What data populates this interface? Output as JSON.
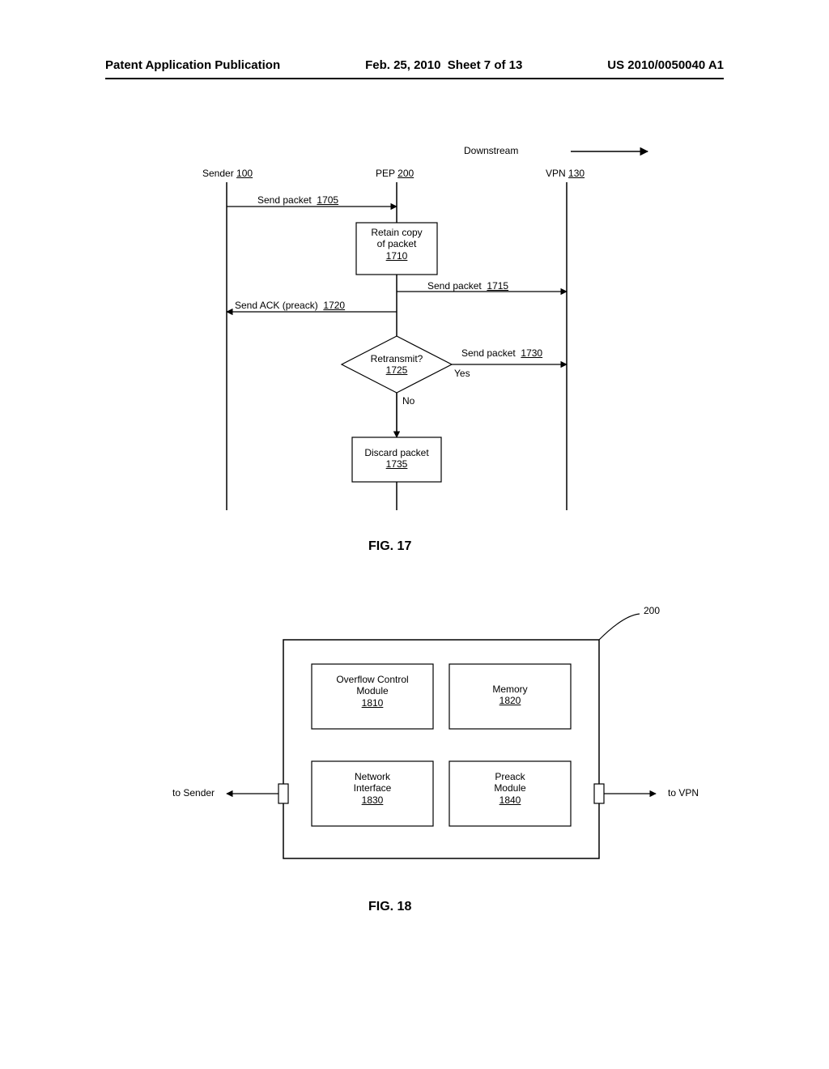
{
  "header": {
    "left": "Patent Application Publication",
    "date": "Feb. 25, 2010  Sheet 7 of 13",
    "right": "US 2010/0050040 A1"
  },
  "fig17": {
    "downstream": "Downstream",
    "lifelines": {
      "sender": {
        "label": "Sender",
        "ref": "100"
      },
      "pep": {
        "label": "PEP",
        "ref": "200"
      },
      "vpn": {
        "label": "VPN",
        "ref": "130"
      }
    },
    "msgs": {
      "send1705": {
        "text": "Send packet",
        "ref": "1705"
      },
      "send1715": {
        "text": "Send packet",
        "ref": "1715"
      },
      "ack1720": {
        "text": "Send ACK (preack)",
        "ref": "1720"
      },
      "send1730": {
        "text": "Send packet",
        "ref": "1730"
      }
    },
    "blocks": {
      "retain": {
        "text": "Retain copy\nof packet",
        "ref": "1710"
      },
      "decision": {
        "text": "Retransmit?",
        "ref": "1725",
        "yes": "Yes",
        "no": "No"
      },
      "discard": {
        "text": "Discard packet",
        "ref": "1735"
      }
    },
    "caption": "FIG. 17"
  },
  "fig18": {
    "ref": "200",
    "left_label": "to Sender",
    "right_label": "to VPN",
    "boxes": {
      "overflow": {
        "text": "Overflow Control\nModule",
        "ref": "1810"
      },
      "memory": {
        "text": "Memory",
        "ref": "1820"
      },
      "netif": {
        "text": "Network\nInterface",
        "ref": "1830"
      },
      "preack": {
        "text": "Preack\nModule",
        "ref": "1840"
      }
    },
    "caption": "FIG. 18"
  }
}
